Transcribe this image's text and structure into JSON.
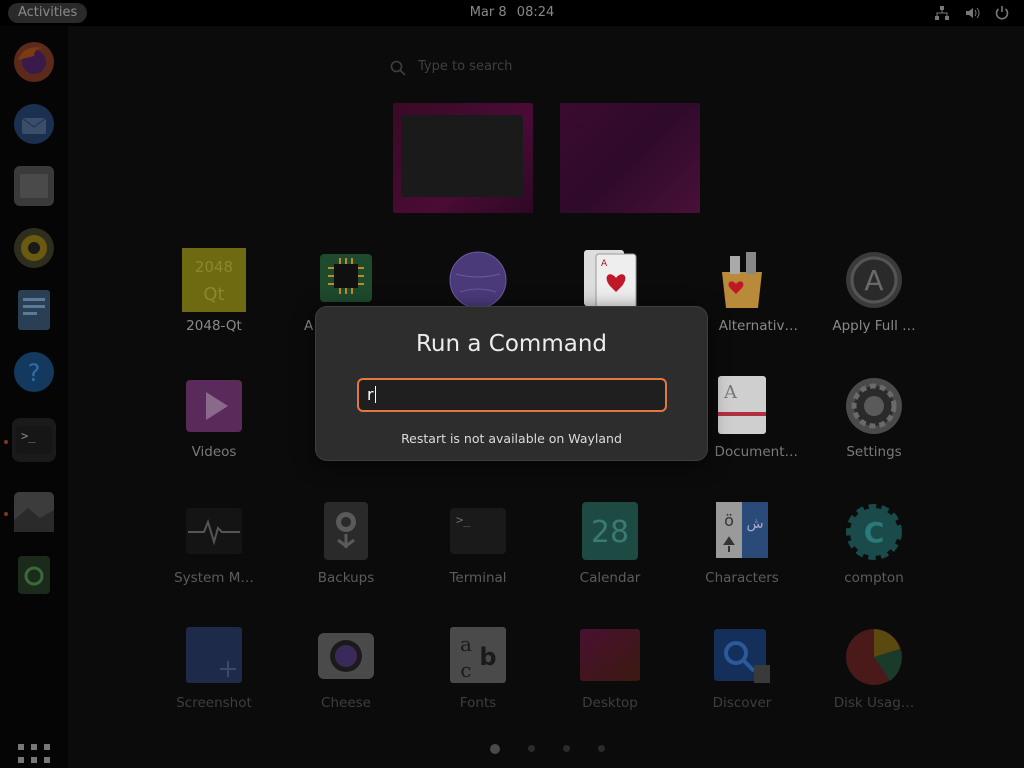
{
  "topbar": {
    "activities_label": "Activities",
    "clock_date": "Mar 8",
    "clock_time": "08:24",
    "tray_icons": [
      "network-icon",
      "volume-icon",
      "power-icon"
    ]
  },
  "dock": {
    "items": [
      "firefox-icon",
      "thunderbird-icon",
      "files-icon",
      "rhythmbox-icon",
      "writer-icon",
      "help-icon",
      "terminal-icon",
      "image-viewer-icon",
      "trash-icon"
    ]
  },
  "search": {
    "placeholder": "Type to search"
  },
  "apps": [
    {
      "label": "2048-Qt",
      "icon": "2048-icon",
      "tile_text": "2048",
      "tile_sub": "Qt"
    },
    {
      "label": "A",
      "icon": "cpu-icon"
    },
    {
      "label": "",
      "icon": "globe-icon"
    },
    {
      "label": "",
      "icon": "solitaire-icon",
      "card": "A"
    },
    {
      "label": "Alternativ…",
      "icon": "alternatives-icon"
    },
    {
      "label": "Apply Full …",
      "icon": "apply-full-icon",
      "glyph": "A"
    },
    {
      "label": "Videos",
      "icon": "videos-icon"
    },
    {
      "label": "",
      "icon": "hidden-icon"
    },
    {
      "label": "",
      "icon": "hidden-icon"
    },
    {
      "label": "",
      "icon": "hidden-icon"
    },
    {
      "label": "Document…",
      "icon": "document-viewer-icon",
      "glyph": "A"
    },
    {
      "label": "Settings",
      "icon": "settings-icon"
    },
    {
      "label": "System M…",
      "icon": "system-monitor-icon"
    },
    {
      "label": "Backups",
      "icon": "backups-icon"
    },
    {
      "label": "Terminal",
      "icon": "terminal-icon",
      "glyph": ">_"
    },
    {
      "label": "Calendar",
      "icon": "calendar-icon",
      "day": "28"
    },
    {
      "label": "Characters",
      "icon": "characters-icon",
      "glyph1": "ö",
      "glyph2": "ش"
    },
    {
      "label": "compton",
      "icon": "compton-icon",
      "glyph": "C"
    },
    {
      "label": "Screenshot",
      "icon": "screenshot-icon"
    },
    {
      "label": "Cheese",
      "icon": "cheese-icon"
    },
    {
      "label": "Fonts",
      "icon": "fonts-icon",
      "glyph1": "a",
      "glyph2": "b",
      "glyph3": "c"
    },
    {
      "label": "Desktop",
      "icon": "desktop-icon"
    },
    {
      "label": "Discover",
      "icon": "discover-icon"
    },
    {
      "label": "Disk Usag…",
      "icon": "disk-usage-icon"
    }
  ],
  "pager": {
    "pages": 4,
    "active": 1
  },
  "run_dialog": {
    "title": "Run a Command",
    "input_value": "r",
    "message": "Restart is not available on Wayland"
  },
  "colors": {
    "accent": "#e2773f",
    "dialog_bg": "#2d2d2d",
    "background": "#0b0b0b"
  }
}
